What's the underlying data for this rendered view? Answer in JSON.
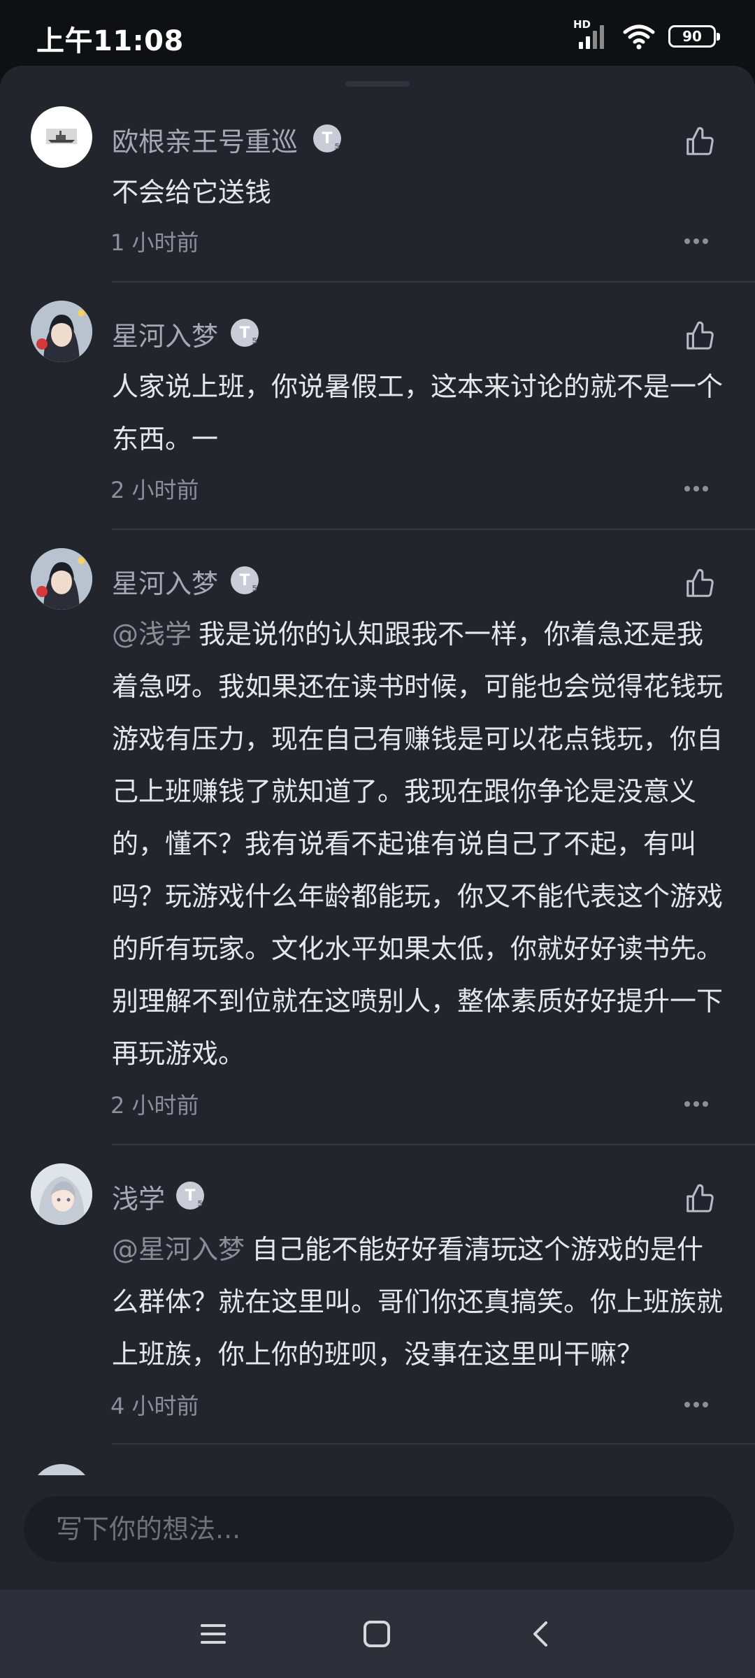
{
  "status_bar": {
    "time": "上午11:08",
    "network_label": "HD",
    "battery": "90"
  },
  "colors": {
    "sheet_background": "#23252c",
    "page_background": "#0f1014",
    "text_primary": "#e6e7ea",
    "text_secondary": "#8d909a",
    "level_badge": "#c9ccd6"
  },
  "comments": [
    {
      "username": "欧根亲王号重巡",
      "level": "T",
      "avatar": "warship-avatar",
      "content": "不会给它送钱",
      "mention": "",
      "time": "1 小时前"
    },
    {
      "username": "星河入梦",
      "level": "T",
      "avatar": "anime-avatar",
      "content": "人家说上班，你说暑假工，这本来讨论的就不是一个东西。一",
      "mention": "",
      "time": "2 小时前"
    },
    {
      "username": "星河入梦",
      "level": "T",
      "avatar": "anime-avatar",
      "mention": "@浅学",
      "content": "我是说你的认知跟我不一样，你着急还是我着急呀。我如果还在读书时候，可能也会觉得花钱玩游戏有压力，现在自己有赚钱是可以花点钱玩，你自己上班赚钱了就知道了。我现在跟你争论是没意义的，懂不？我有说看不起谁有说自己了不起，有叫吗？玩游戏什么年龄都能玩，你又不能代表这个游戏的所有玩家。文化水平如果太低，你就好好读书先。别理解不到位就在这喷别人，整体素质好好提升一下再玩游戏。",
      "time": "2 小时前"
    },
    {
      "username": "浅学",
      "level": "T",
      "avatar": "silver-hair-avatar",
      "mention": "@星河入梦",
      "content": "自己能不能好好看清玩这个游戏的是什么群体？就在这里叫。哥们你还真搞笑。你上班族就上班族，你上你的班呗，没事在这里叫干嘛？",
      "time": "4 小时前"
    }
  ],
  "input": {
    "placeholder": "写下你的想法..."
  },
  "nav_bar": {
    "menu_icon": "menu-icon",
    "home_icon": "home-icon",
    "back_icon": "back-icon"
  }
}
